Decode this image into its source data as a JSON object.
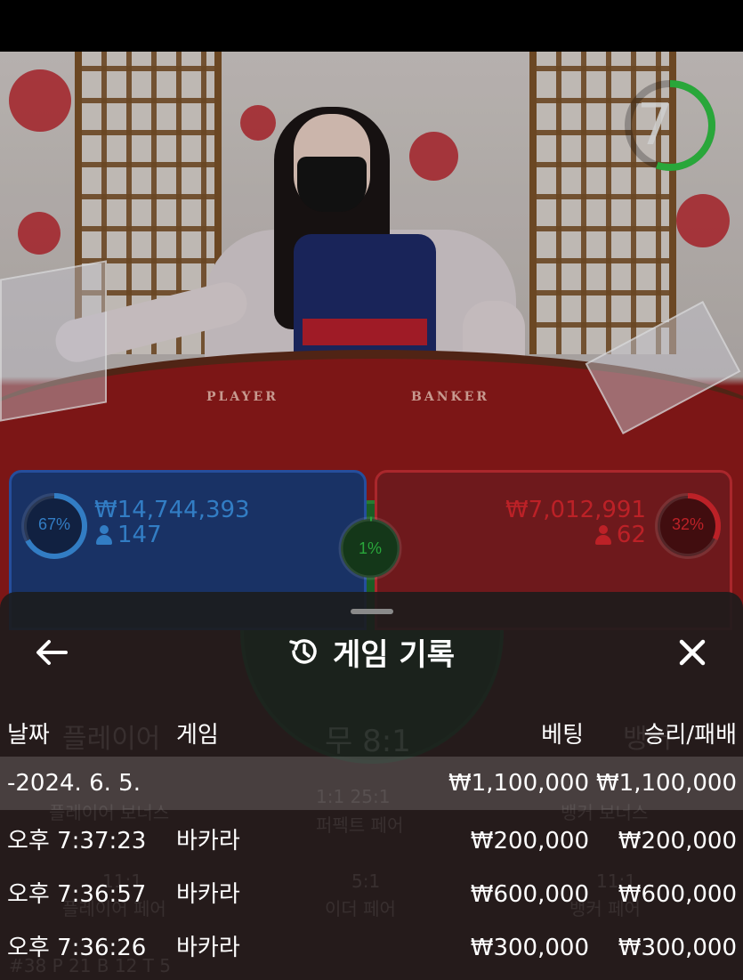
{
  "timer": {
    "value": "7",
    "progress": 0.55
  },
  "table_labels": {
    "player": "PLAYER",
    "banker": "BANKER"
  },
  "bets": {
    "player": {
      "percent": "67%",
      "fraction": 0.67,
      "amount": "₩14,744,393",
      "count": "147"
    },
    "banker": {
      "percent": "32%",
      "fraction": 0.32,
      "amount": "₩7,012,991",
      "count": "62"
    },
    "tie": {
      "percent": "1%",
      "fraction": 0.01
    }
  },
  "background_ghost_text": {
    "player_label": "플레이어",
    "tie_label": "무 8:1",
    "banker_label": "뱅커",
    "player_bonus": "플레이어 보너스",
    "perfect_pair": "퍼펙트 페어",
    "banker_bonus": "뱅커 보너스",
    "player_pair": "플레이어 페어",
    "either_pair": "이더 페어",
    "banker_pair": "뱅커 페어",
    "perfect_pair_odds": "1:1  25:1",
    "player_pair_odds": "11:1",
    "either_pair_odds": "5:1",
    "banker_pair_odds": "11:1",
    "footer_counts": "#38   P 21   B 12   T 5"
  },
  "sheet": {
    "title": "게임 기록",
    "back_icon": "arrow-left-icon",
    "history_icon": "history-icon",
    "close_icon": "close-icon",
    "columns": {
      "date": "날짜",
      "game": "게임",
      "bet": "베팅",
      "result": "승리/패배"
    },
    "date_row": {
      "date": "-2024. 6. 5.",
      "bet": "₩1,100,000",
      "result": "₩1,100,000"
    },
    "rows": [
      {
        "time": "오후 7:37:23",
        "game": "바카라",
        "bet": "₩200,000",
        "result": "₩200,000"
      },
      {
        "time": "오후 7:36:57",
        "game": "바카라",
        "bet": "₩600,000",
        "result": "₩600,000"
      },
      {
        "time": "오후 7:36:26",
        "game": "바카라",
        "bet": "₩300,000",
        "result": "₩300,000"
      }
    ]
  },
  "colors": {
    "player_blue": "#3a8fe0",
    "banker_red": "#d7262d",
    "tie_green": "#2fbf43",
    "sheet_bg": "#1c1c1c"
  }
}
